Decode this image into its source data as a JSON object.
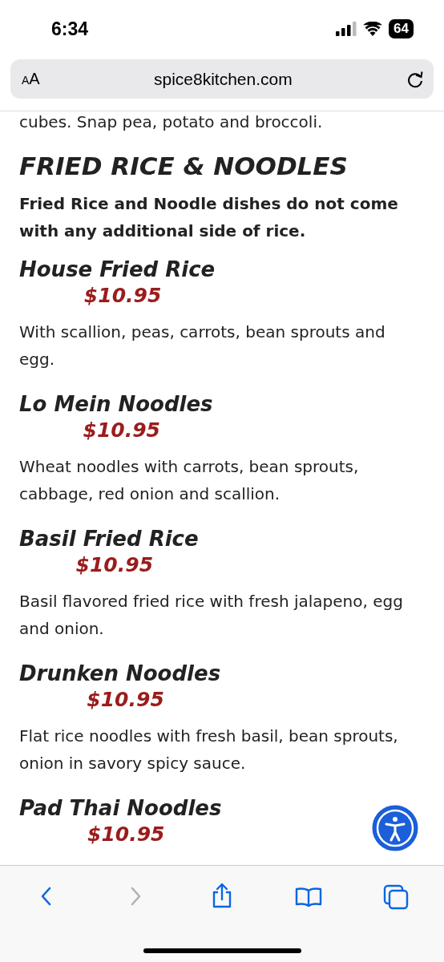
{
  "status_bar": {
    "time": "6:34",
    "battery": "64"
  },
  "address_bar": {
    "text_size_button": "AA",
    "url": "spice8kitchen.com"
  },
  "page": {
    "cut_line": "cubes. Snap pea, potato and broccoli.",
    "heading": "FRIED RICE & NOODLES",
    "note": "Fried Rice and Noodle dishes do not come with any additional side of rice.",
    "items": [
      {
        "name": "House Fried Rice",
        "price": "$10.95",
        "description": "With scallion, peas, carrots, bean sprouts and egg."
      },
      {
        "name": "Lo Mein Noodles",
        "price": "$10.95",
        "description": "Wheat noodles with carrots, bean sprouts, cabbage, red onion and scallion."
      },
      {
        "name": "Basil Fried Rice",
        "price": "$10.95",
        "description": "Basil flavored fried rice with fresh jalapeno, egg and onion."
      },
      {
        "name": "Drunken Noodles",
        "price": "$10.95",
        "description": "Flat rice noodles with fresh basil, bean sprouts, onion in savory spicy sauce."
      },
      {
        "name": "Pad Thai Noodles",
        "price": "$10.95"
      }
    ]
  },
  "toolbar": {
    "buttons": [
      {
        "kind": "back",
        "disabled": false
      },
      {
        "kind": "forward",
        "disabled": true
      },
      {
        "kind": "share",
        "disabled": false
      },
      {
        "kind": "bookmarks",
        "disabled": false
      },
      {
        "kind": "tabs",
        "disabled": false
      }
    ]
  }
}
